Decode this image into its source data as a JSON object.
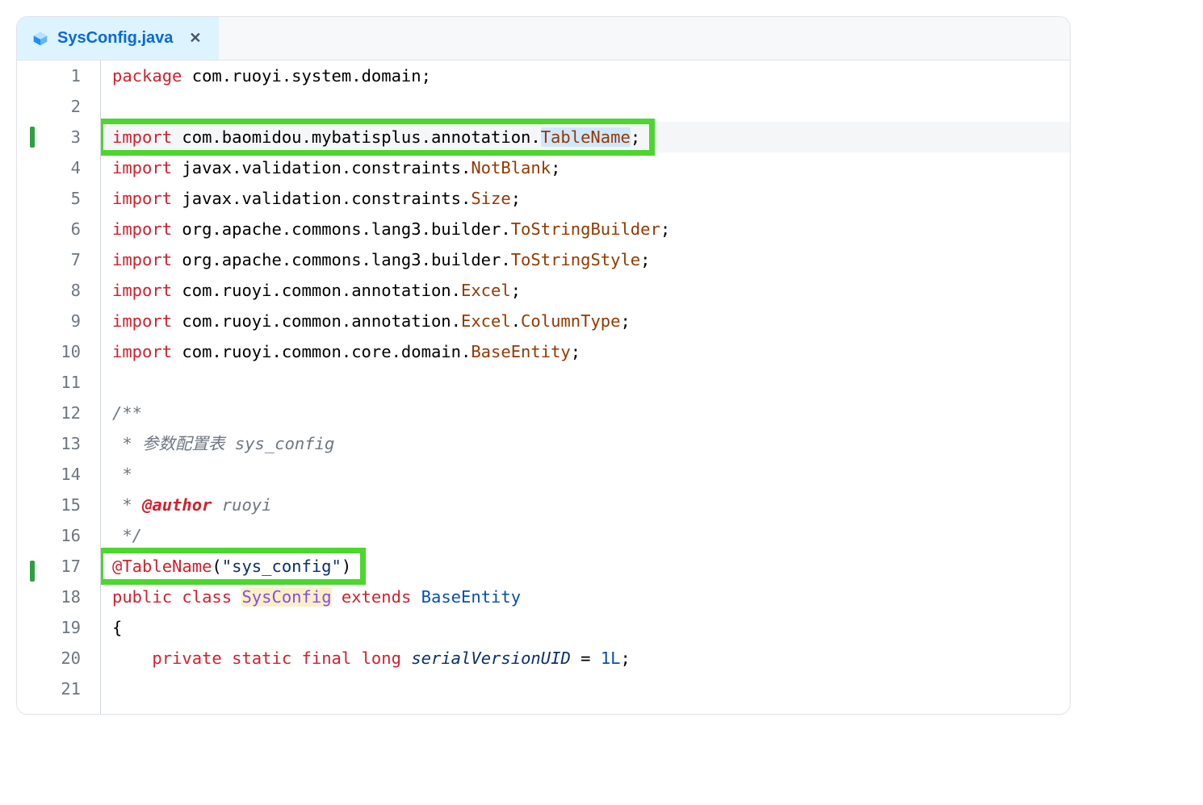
{
  "tab": {
    "filename": "SysConfig.java",
    "close_tooltip": "Close"
  },
  "lines": [
    {
      "n": 1,
      "mod": false,
      "kind": "pkg",
      "tokens": [
        "package",
        " com.ruoyi.system.domain;"
      ]
    },
    {
      "n": 2,
      "mod": false,
      "kind": "blank",
      "tokens": [
        ""
      ]
    },
    {
      "n": 3,
      "mod": true,
      "kind": "import",
      "tokens": [
        "import",
        " com.baomidou.mybatisplus.annotation.",
        "TableName",
        ";"
      ],
      "current": true,
      "highlight_box": true,
      "selected_part": "TableName"
    },
    {
      "n": 4,
      "mod": false,
      "kind": "import",
      "tokens": [
        "import",
        " javax.validation.constraints.",
        "NotBlank",
        ";"
      ]
    },
    {
      "n": 5,
      "mod": false,
      "kind": "import",
      "tokens": [
        "import",
        " javax.validation.constraints.",
        "Size",
        ";"
      ]
    },
    {
      "n": 6,
      "mod": false,
      "kind": "import",
      "tokens": [
        "import",
        " org.apache.commons.lang3.builder.",
        "ToStringBuilder",
        ";"
      ]
    },
    {
      "n": 7,
      "mod": false,
      "kind": "import",
      "tokens": [
        "import",
        " org.apache.commons.lang3.builder.",
        "ToStringStyle",
        ";"
      ]
    },
    {
      "n": 8,
      "mod": false,
      "kind": "import",
      "tokens": [
        "import",
        " com.ruoyi.common.annotation.",
        "Excel",
        ";"
      ]
    },
    {
      "n": 9,
      "mod": false,
      "kind": "import2",
      "tokens": [
        "import",
        " com.ruoyi.common.annotation.",
        "Excel",
        ".",
        "ColumnType",
        ";"
      ]
    },
    {
      "n": 10,
      "mod": false,
      "kind": "import",
      "tokens": [
        "import",
        " com.ruoyi.common.core.domain.",
        "BaseEntity",
        ";"
      ]
    },
    {
      "n": 11,
      "mod": false,
      "kind": "blank",
      "tokens": [
        ""
      ]
    },
    {
      "n": 12,
      "mod": false,
      "kind": "cmt",
      "tokens": [
        "/**"
      ]
    },
    {
      "n": 13,
      "mod": false,
      "kind": "cmt",
      "tokens": [
        " * 参数配置表 sys_config"
      ]
    },
    {
      "n": 14,
      "mod": false,
      "kind": "cmt",
      "tokens": [
        " *"
      ]
    },
    {
      "n": 15,
      "mod": false,
      "kind": "cmt-a",
      "tokens": [
        " * ",
        "@author",
        " ruoyi"
      ]
    },
    {
      "n": 16,
      "mod": false,
      "kind": "cmt",
      "tokens": [
        " */"
      ]
    },
    {
      "n": 17,
      "mod": true,
      "kind": "ann",
      "tokens": [
        "@TableName",
        "(",
        "\"sys_config\"",
        ")"
      ],
      "highlight_box": true
    },
    {
      "n": 18,
      "mod": false,
      "kind": "class",
      "tokens": [
        "public",
        " ",
        "class",
        " ",
        "SysConfig",
        " ",
        "extends",
        " ",
        "BaseEntity"
      ]
    },
    {
      "n": 19,
      "mod": false,
      "kind": "plain",
      "tokens": [
        "{"
      ]
    },
    {
      "n": 20,
      "mod": false,
      "kind": "field",
      "tokens": [
        "    ",
        "private",
        " ",
        "static",
        " ",
        "final",
        " ",
        "long",
        " ",
        "serialVersionUID",
        " = ",
        "1L",
        ";"
      ]
    },
    {
      "n": 21,
      "mod": false,
      "kind": "blank",
      "tokens": [
        ""
      ]
    }
  ]
}
